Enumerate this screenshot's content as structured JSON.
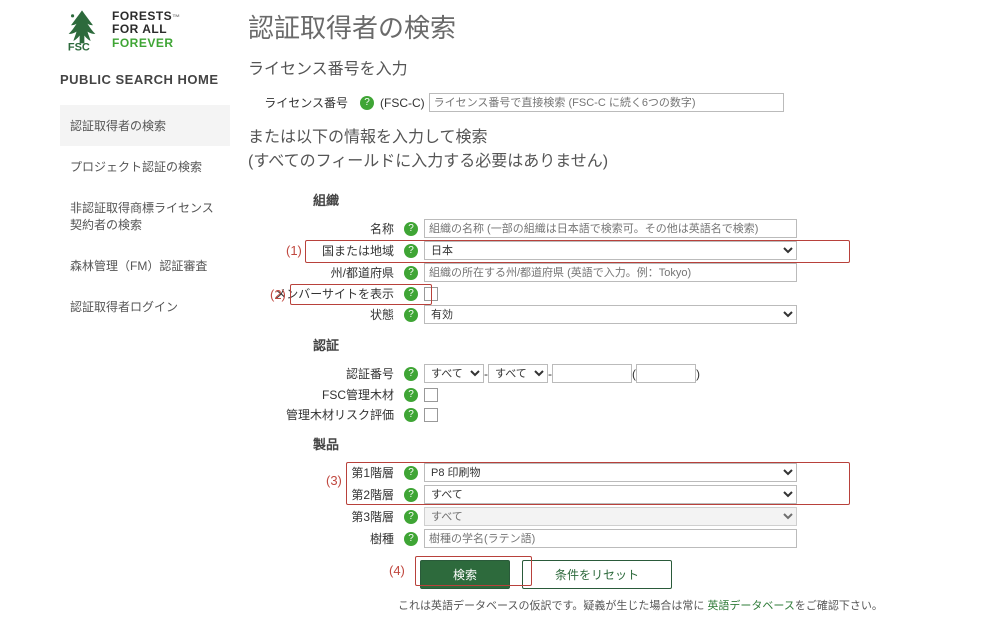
{
  "logo": {
    "line1": "FORESTS",
    "line2": "FOR ALL",
    "line3": "FOREVER",
    "sub": "FSC",
    "tm": "™"
  },
  "sidebar": {
    "home_label": "PUBLIC SEARCH HOME",
    "items": [
      "認証取得者の検索",
      "プロジェクト認証の検索",
      "非認証取得商標ライセンス契約者の検索",
      "森林管理（FM）認証審査",
      "認証取得者ログイン"
    ]
  },
  "page_title": "認証取得者の検索",
  "sub_title": "ライセンス番号を入力",
  "license": {
    "label": "ライセンス番号",
    "prefix": "(FSC-C)",
    "placeholder": "ライセンス番号で直接検索 (FSC-C に続く6つの数字)"
  },
  "or_text1": "または以下の情報を入力して検索",
  "or_text2": "(すべてのフィールドに入力する必要はありません)",
  "sections": {
    "org": "組織",
    "cert": "認証",
    "product": "製品"
  },
  "org": {
    "name_label": "名称",
    "name_placeholder": "組織の名称 (一部の組織は日本語で検索可。その他は英語名で検索)",
    "country_label": "国または地域",
    "country_value": "日本",
    "state_label": "州/都道府県",
    "state_placeholder": "組織の所在する州/都道府県 (英語で入力。例：Tokyo)",
    "members_label": "メンバーサイトを表示",
    "status_label": "状態",
    "status_value": "有効"
  },
  "cert": {
    "certno_label": "認証番号",
    "select_all": "すべて",
    "dash": "-",
    "fsccw_label": "FSC管理木材",
    "cwrisk_label": "管理木材リスク評価"
  },
  "product": {
    "lvl1_label": "第1階層",
    "lvl1_value": "P8 印刷物",
    "lvl2_label": "第2階層",
    "lvl2_value": "すべて",
    "lvl3_label": "第3階層",
    "lvl3_value": "すべて",
    "species_label": "樹種",
    "species_placeholder": "樹種の学名(ラテン語)"
  },
  "annotations": {
    "a1": "(1)",
    "a2": "(2)",
    "a3": "(3)",
    "a4": "(4)"
  },
  "buttons": {
    "search": "検索",
    "reset": "条件をリセット"
  },
  "footnote": {
    "pre": "これは英語データベースの仮訳です。疑義が生じた場合は常に ",
    "link": "英語データベース",
    "post": "をご確認下さい。"
  }
}
